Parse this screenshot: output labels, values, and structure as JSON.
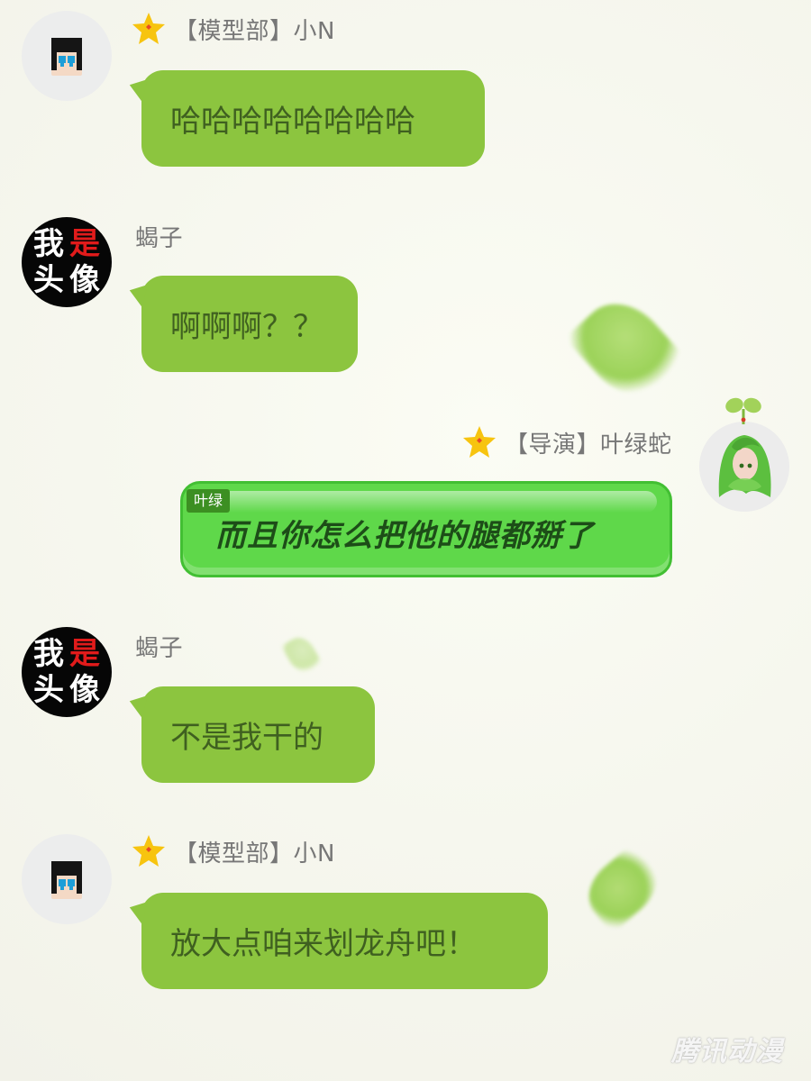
{
  "messages": [
    {
      "sender": "【模型部】小N",
      "text": "哈哈哈哈哈哈哈哈"
    },
    {
      "sender": "蝎子",
      "text": "啊啊啊？？"
    },
    {
      "sender": "【导演】叶绿蛇",
      "tag": "叶绿",
      "text": "而且你怎么把他的腿都掰了"
    },
    {
      "sender": "蝎子",
      "text": "不是我干的"
    },
    {
      "sender": "【模型部】小N",
      "text": "放大点咱来划龙舟吧！"
    }
  ],
  "avatars": {
    "scorpion": [
      "我",
      "是",
      "头",
      "像"
    ]
  },
  "watermark": "腾讯动漫",
  "icons": {
    "rank_badge": "star-icon",
    "avatar_pixel": "pixel-face-avatar",
    "avatar_text": "text-avatar",
    "avatar_sprout": "sprout-avatar"
  },
  "colors": {
    "bubble_green": "#8cc53f",
    "special_bubble_green": "#5fd84a",
    "name_gray": "#777777",
    "avatar_red": "#e11b1b",
    "star_yellow": "#f7c40f"
  }
}
